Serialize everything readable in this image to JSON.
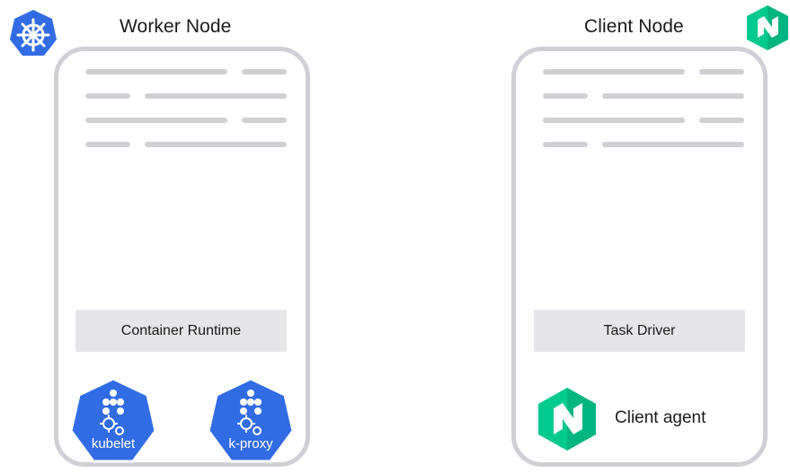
{
  "worker": {
    "title": "Worker Node",
    "runtime_label": "Container Runtime",
    "components": [
      {
        "label": "kubelet",
        "icon": "kubelet-icon"
      },
      {
        "label": "k-proxy",
        "icon": "kube-proxy-icon"
      }
    ],
    "brand_icon": "kubernetes-logo-icon"
  },
  "client": {
    "title": "Client Node",
    "driver_label": "Task Driver",
    "agent_label": "Client agent",
    "brand_icon": "nomad-logo-icon"
  },
  "colors": {
    "kubernetes_blue": "#326ce5",
    "nomad_green": "#00ca8e",
    "nomad_dark_green": "#008f63",
    "frame_gray": "#cfcfd6",
    "bar_gray": "#e6e6ea"
  }
}
